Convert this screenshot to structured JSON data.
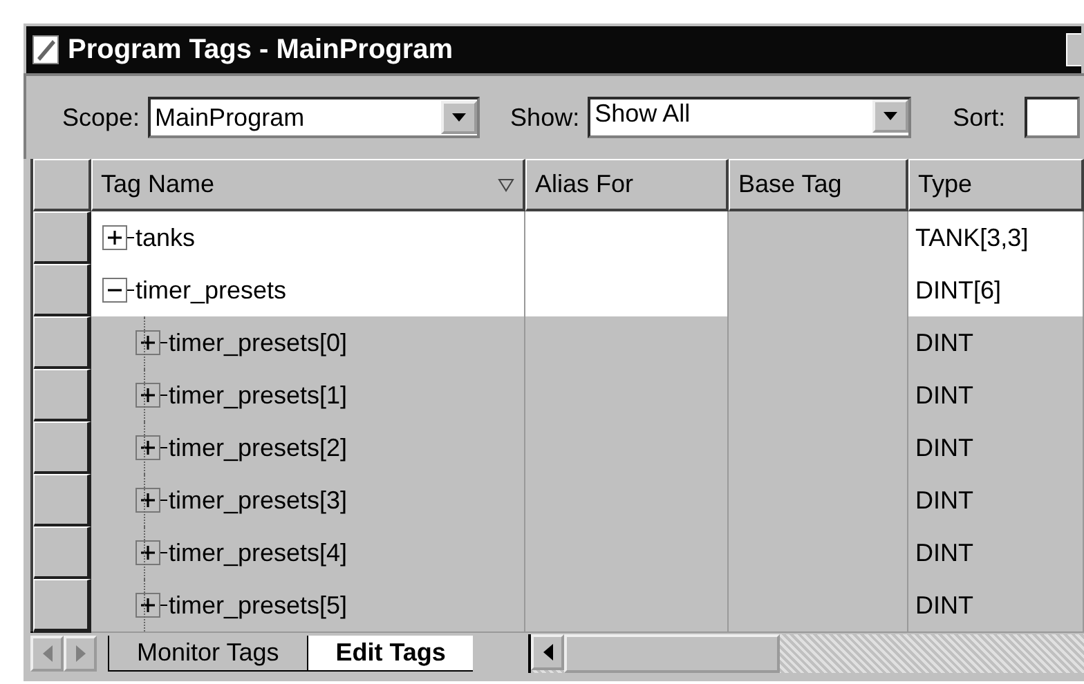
{
  "window": {
    "title": "Program Tags - MainProgram"
  },
  "toolbar": {
    "scope_label": "Scope:",
    "scope_value": "MainProgram",
    "show_label": "Show:",
    "show_value": "Show All",
    "sort_label": "Sort:"
  },
  "table": {
    "columns": [
      "Tag Name",
      "Alias For",
      "Base Tag",
      "Type"
    ],
    "rows": [
      {
        "name": "tanks",
        "type": "TANK[3,3]",
        "expanded": false
      },
      {
        "name": "timer_presets",
        "type": "DINT[6]",
        "expanded": true,
        "children": [
          {
            "name": "timer_presets[0]",
            "type": "DINT",
            "expanded": false
          },
          {
            "name": "timer_presets[1]",
            "type": "DINT",
            "expanded": false
          },
          {
            "name": "timer_presets[2]",
            "type": "DINT",
            "expanded": false
          },
          {
            "name": "timer_presets[3]",
            "type": "DINT",
            "expanded": false
          },
          {
            "name": "timer_presets[4]",
            "type": "DINT",
            "expanded": false
          },
          {
            "name": "timer_presets[5]",
            "type": "DINT",
            "expanded": false
          }
        ]
      }
    ]
  },
  "tabs": [
    {
      "label": "Monitor Tags",
      "selected": false
    },
    {
      "label": "Edit Tags",
      "selected": true
    }
  ]
}
